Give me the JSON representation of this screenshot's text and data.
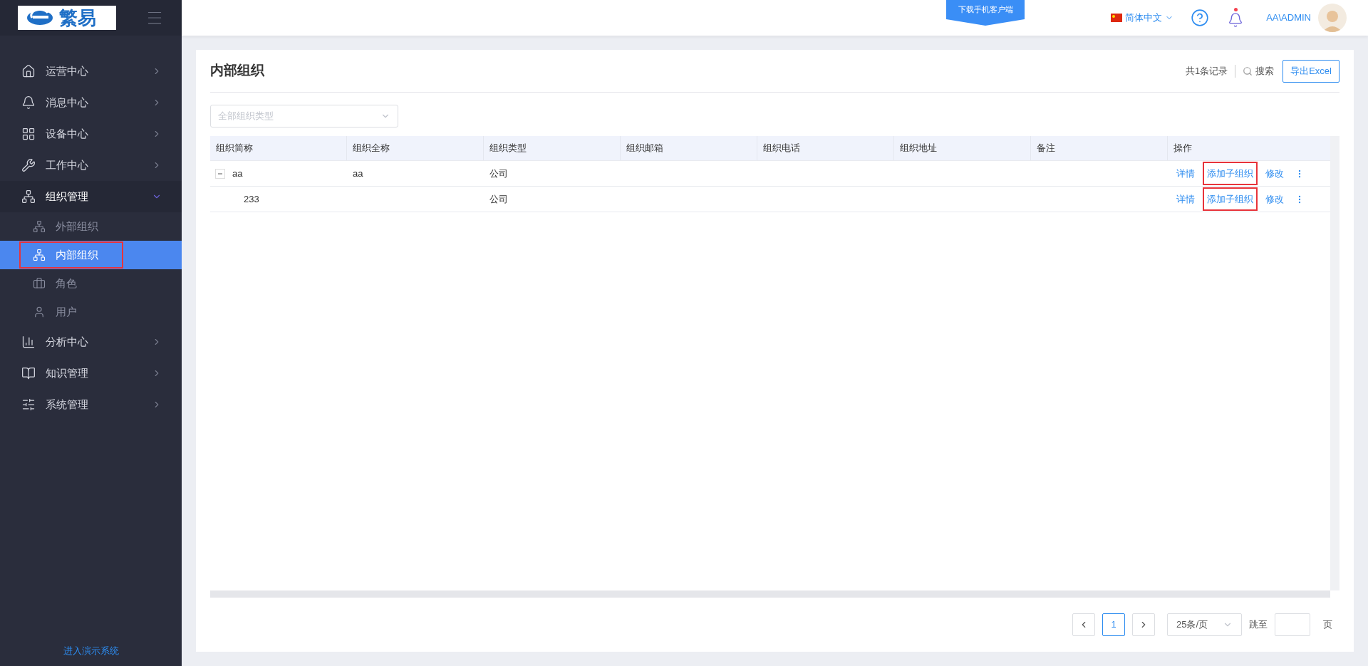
{
  "sidebar": {
    "logo": "繁易",
    "menu": [
      {
        "label": "运营中心",
        "expanded": false
      },
      {
        "label": "消息中心",
        "expanded": false
      },
      {
        "label": "设备中心",
        "expanded": false
      },
      {
        "label": "工作中心",
        "expanded": false
      },
      {
        "label": "组织管理",
        "expanded": true,
        "children": [
          {
            "label": "外部组织",
            "selected": false,
            "highlighted": false
          },
          {
            "label": "内部组织",
            "selected": true,
            "highlighted": true
          },
          {
            "label": "角色",
            "selected": false,
            "highlighted": false
          },
          {
            "label": "用户",
            "selected": false,
            "highlighted": false
          }
        ]
      },
      {
        "label": "分析中心",
        "expanded": false
      },
      {
        "label": "知识管理",
        "expanded": false
      },
      {
        "label": "系统管理",
        "expanded": false
      }
    ],
    "footer_link": "进入演示系统"
  },
  "header": {
    "download_banner": "下载手机客户端",
    "language": "简体中文",
    "notifications": true,
    "user": "AA\\ADMIN"
  },
  "page": {
    "title": "内部组织",
    "record_count": "共1条记录",
    "search": "搜索",
    "export_button": "导出Excel",
    "filter": {
      "placeholder": "全部组织类型"
    },
    "table": {
      "columns": [
        "组织简称",
        "组织全称",
        "组织类型",
        "组织邮箱",
        "组织电话",
        "组织地址",
        "备注",
        "操作"
      ],
      "rows": [
        {
          "cells": [
            "aa",
            "aa",
            "公司",
            "",
            "",
            "",
            ""
          ],
          "expanded": true,
          "actions": [
            {
              "label": "详情",
              "highlighted": false
            },
            {
              "label": "添加子组织",
              "highlighted": true
            },
            {
              "label": "修改",
              "highlighted": false
            }
          ],
          "children": [
            {
              "cells": [
                "233",
                "",
                "公司",
                "",
                "",
                "",
                ""
              ],
              "actions": [
                {
                  "label": "详情",
                  "highlighted": false
                },
                {
                  "label": "添加子组织",
                  "highlighted": true
                },
                {
                  "label": "修改",
                  "highlighted": false
                }
              ]
            }
          ]
        }
      ]
    },
    "pagination": {
      "pages": [
        {
          "label": "1",
          "selected": true
        }
      ],
      "page_size": "25条/页",
      "jump_label": "跳至",
      "page_suffix": "页"
    }
  }
}
